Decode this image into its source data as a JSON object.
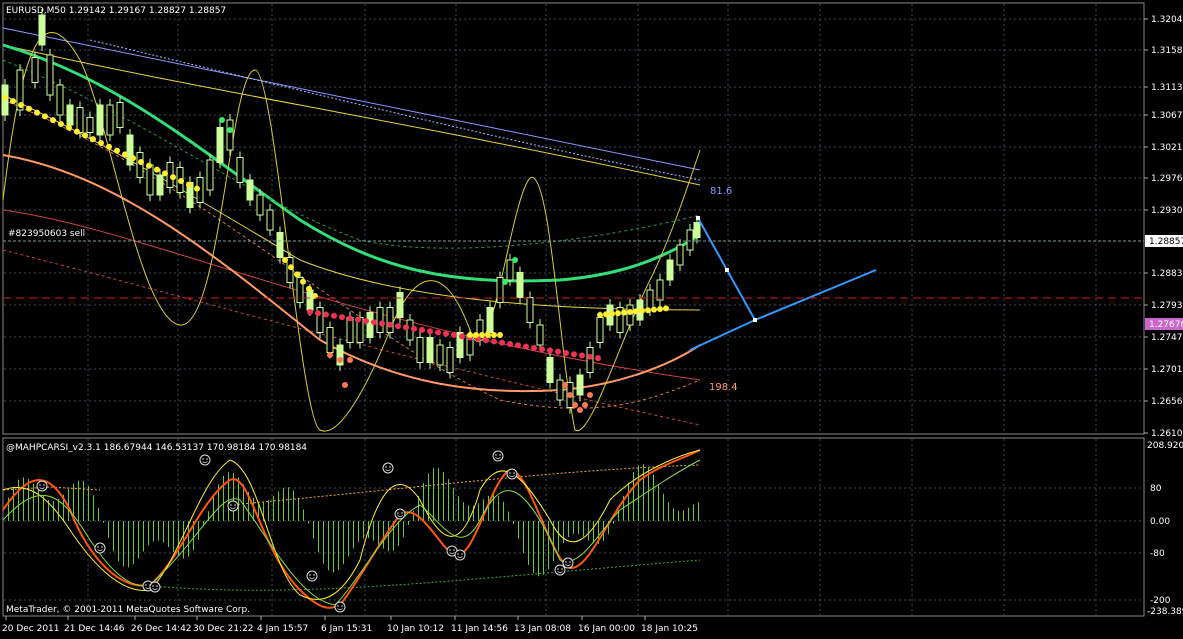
{
  "main_panel": {
    "header": "EURUSD,M50  1.29142 1.29167 1.28827 1.28857",
    "order_label": "#823950603 sell",
    "current_price": "1.28857",
    "marker_price": "1.27676",
    "price_ticks": [
      "1.32040",
      "1.31585",
      "1.31130",
      "1.30675",
      "1.30215",
      "1.29760",
      "1.29300",
      "1.28830",
      "1.27930",
      "1.27470",
      "1.27010",
      "1.26560",
      "1.26100"
    ],
    "annotation_upper": "81.6",
    "annotation_lower": "198.4"
  },
  "indicator_panel": {
    "header": "@MAHPCARSI_v2.3.1 186.67944 146.53137 170.98184 170.98184",
    "scale_top": "208.9205",
    "ticks": [
      "80",
      "0.00",
      "-80",
      "-200"
    ],
    "scale_bottom": "-238.3895"
  },
  "time_axis": [
    "20 Dec 2011",
    "21 Dec 14:46",
    "26 Dec 14:42",
    "30 Dec 21:22",
    "4 Jan 15:57",
    "6 Jan 15:31",
    "10 Jan 10:12",
    "11 Jan 14:56",
    "13 Jan 08:08",
    "16 Jan 00:00",
    "18 Jan 10:25"
  ],
  "copyright": "MetaTrader, © 2001-2011 MetaQuotes Software Corp.",
  "colors": {
    "background": "#000000",
    "grid": "#3a4a5a",
    "bull_candle": "#ccff99",
    "bear_candle": "#ccff99",
    "ma_green": "#33dd77",
    "ma_orange": "#ff9966",
    "ma_red": "#cc3333",
    "yellow": "#ffee44",
    "blue_projection": "#3399ff",
    "osc_orange": "#ff5511",
    "histogram": "#66cc33"
  }
}
